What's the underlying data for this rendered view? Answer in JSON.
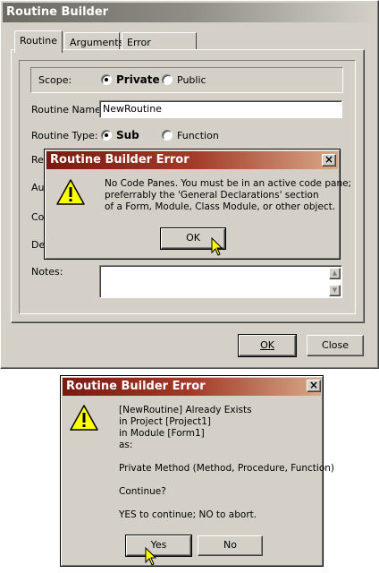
{
  "main_window": {
    "title": "Routine Builder",
    "tabs": [
      {
        "label": "Routine",
        "active": true
      },
      {
        "label": "Arguments",
        "active": false
      },
      {
        "label": "Error Handling",
        "active": false
      }
    ],
    "scope": {
      "label": "Scope:",
      "options": [
        "Private",
        "Public"
      ],
      "selected": "Private"
    },
    "routine_name": {
      "label": "Routine Name:",
      "value": "NewRoutine"
    },
    "routine_type": {
      "label": "Routine Type:",
      "options": [
        "Sub",
        "Function"
      ],
      "selected": "Sub"
    },
    "hidden_labels": [
      "Ret",
      "Aut",
      "Cop",
      "Des"
    ],
    "notes_label": "Notes:",
    "ok_label": "OK",
    "close_label": "Close"
  },
  "error_dialog_1": {
    "title": "Routine Builder Error",
    "message_lines": [
      "No Code Panes. You must be in an active code pane;",
      "preferrably the 'General Declarations' section",
      "of a Form, Module, Class Module, or other object."
    ],
    "ok_label": "OK",
    "icon": "warning-icon"
  },
  "error_dialog_2": {
    "title": "Routine Builder Error",
    "message_lines": [
      "[NewRoutine] Already Exists",
      "in Project [Project1]",
      "in Module [Form1]",
      "as:"
    ],
    "method_line": "Private Method (Method, Procedure, Function)",
    "continue_line": "Continue?",
    "instruction_line": "YES to continue; NO to abort.",
    "yes_label": "Yes",
    "no_label": "No",
    "icon": "warning-icon"
  },
  "close_glyph": "×",
  "scroll_up_glyph": "▲",
  "scroll_down_glyph": "▼",
  "colors": {
    "face": "#d4d0c8",
    "main_titlebar": "#6b6b63",
    "error_titlebar": "#7a1a10",
    "warning_yellow": "#ffff00"
  }
}
